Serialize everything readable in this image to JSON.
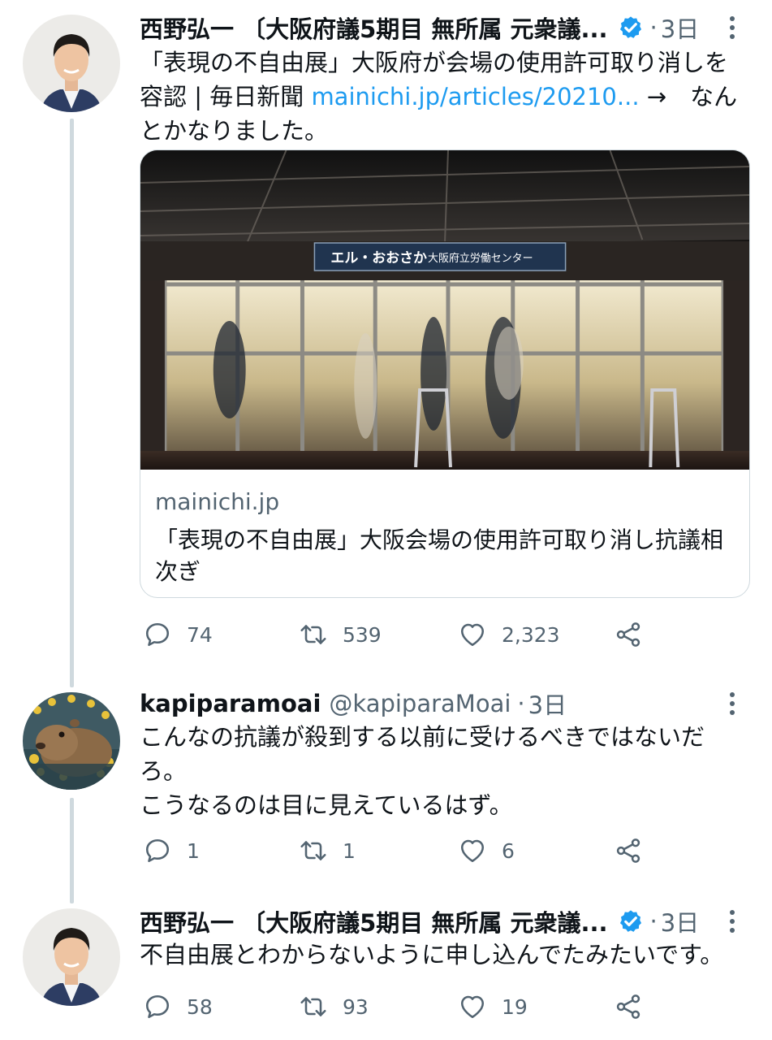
{
  "tweets": [
    {
      "name": "西野弘一 〔大阪府議5期目 無所属 元衆議...",
      "dot": "·",
      "time": "3日",
      "verified": true,
      "text_before": "「表現の不自由展」大阪府が会場の使用許可取り消しを容認 | 毎日新聞 ",
      "link": "mainichi.jp/articles/20210...",
      "text_after": " →　なんとかなりました。",
      "card": {
        "sign_main": "エル・おおさか",
        "sign_sub": "大阪府立労働センター",
        "domain": "mainichi.jp",
        "title": "「表現の不自由展」大阪会場の使用許可取り消し抗議相次ぎ"
      },
      "actions": {
        "replies": "74",
        "retweets": "539",
        "likes": "2,323"
      }
    },
    {
      "name": "kapiparamoai",
      "handle": "@kapiparaMoai",
      "dot": "·",
      "time": "3日",
      "text": "こんなの抗議が殺到する以前に受けるべきではないだろ。\nこうなるのは目に見えているはず。",
      "actions": {
        "replies": "1",
        "retweets": "1",
        "likes": "6"
      }
    },
    {
      "name": "西野弘一 〔大阪府議5期目 無所属 元衆議...",
      "dot": "·",
      "time": "3日",
      "verified": true,
      "text": "不自由展とわからないように申し込んでたみたいです。",
      "actions": {
        "replies": "58",
        "retweets": "93",
        "likes": "19"
      }
    }
  ],
  "icons": {
    "reply": "reply-icon",
    "retweet": "retweet-icon",
    "like": "heart-icon",
    "share": "share-icon",
    "verified": "verified-badge-icon",
    "more": "more-vertical-icon"
  },
  "colors": {
    "accent": "#1d9bf0",
    "text": "#0f1419",
    "secondary": "#536471",
    "thread_line": "#cfd9de"
  }
}
